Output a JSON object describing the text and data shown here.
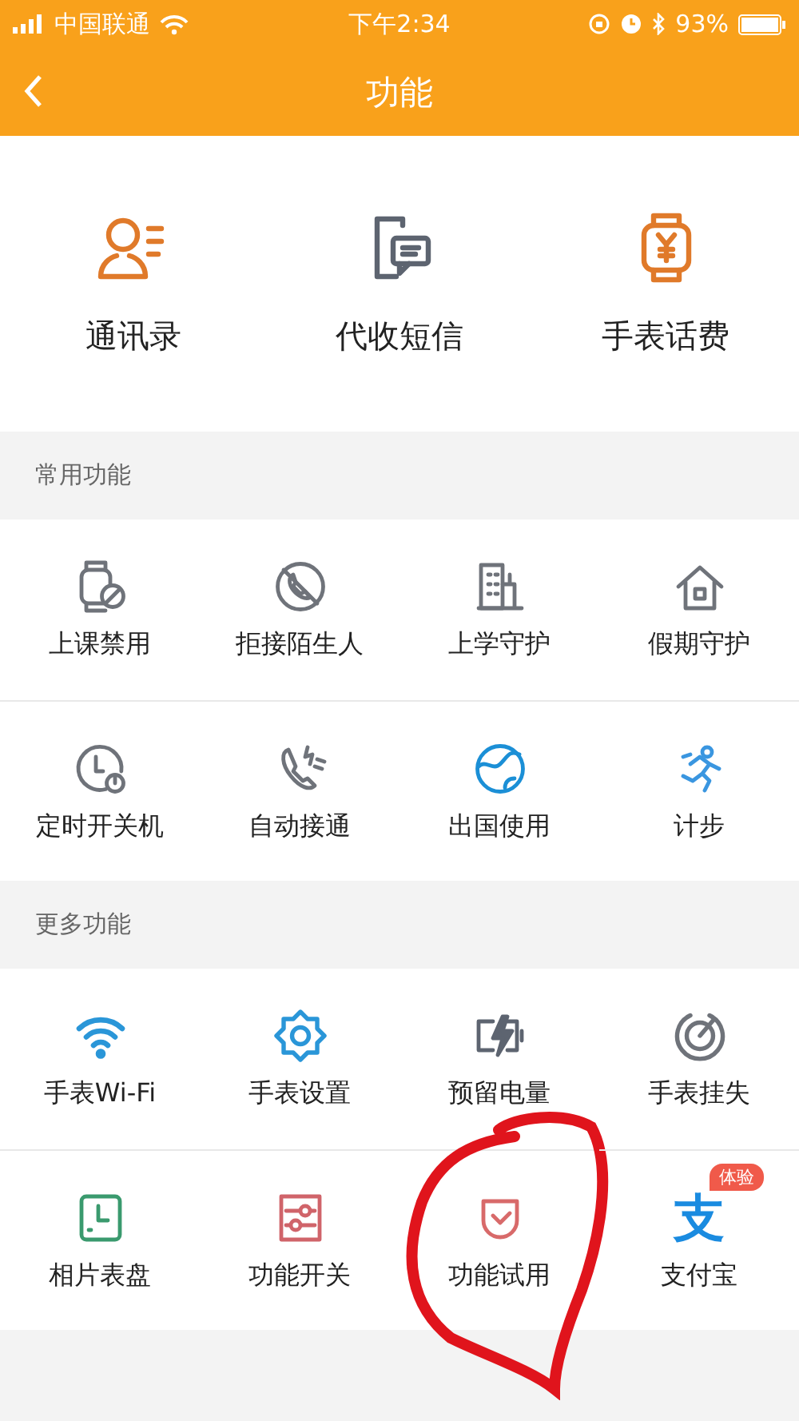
{
  "status_bar": {
    "carrier": "中国联通",
    "time": "下午2:34",
    "battery": "93%"
  },
  "nav": {
    "title": "功能"
  },
  "top_items": [
    {
      "label": "通讯录"
    },
    {
      "label": "代收短信"
    },
    {
      "label": "手表话费"
    }
  ],
  "sections": [
    {
      "title": "常用功能",
      "items": [
        {
          "label": "上课禁用"
        },
        {
          "label": "拒接陌生人"
        },
        {
          "label": "上学守护"
        },
        {
          "label": "假期守护"
        },
        {
          "label": "定时开关机"
        },
        {
          "label": "自动接通"
        },
        {
          "label": "出国使用"
        },
        {
          "label": "计步"
        }
      ]
    },
    {
      "title": "更多功能",
      "items": [
        {
          "label": "手表Wi-Fi"
        },
        {
          "label": "手表设置"
        },
        {
          "label": "预留电量"
        },
        {
          "label": "手表挂失"
        },
        {
          "label": "相片表盘"
        },
        {
          "label": "功能开关"
        },
        {
          "label": "功能试用",
          "highlighted": true
        },
        {
          "label": "支付宝",
          "glyph": "支",
          "badge": "体验"
        }
      ]
    }
  ]
}
